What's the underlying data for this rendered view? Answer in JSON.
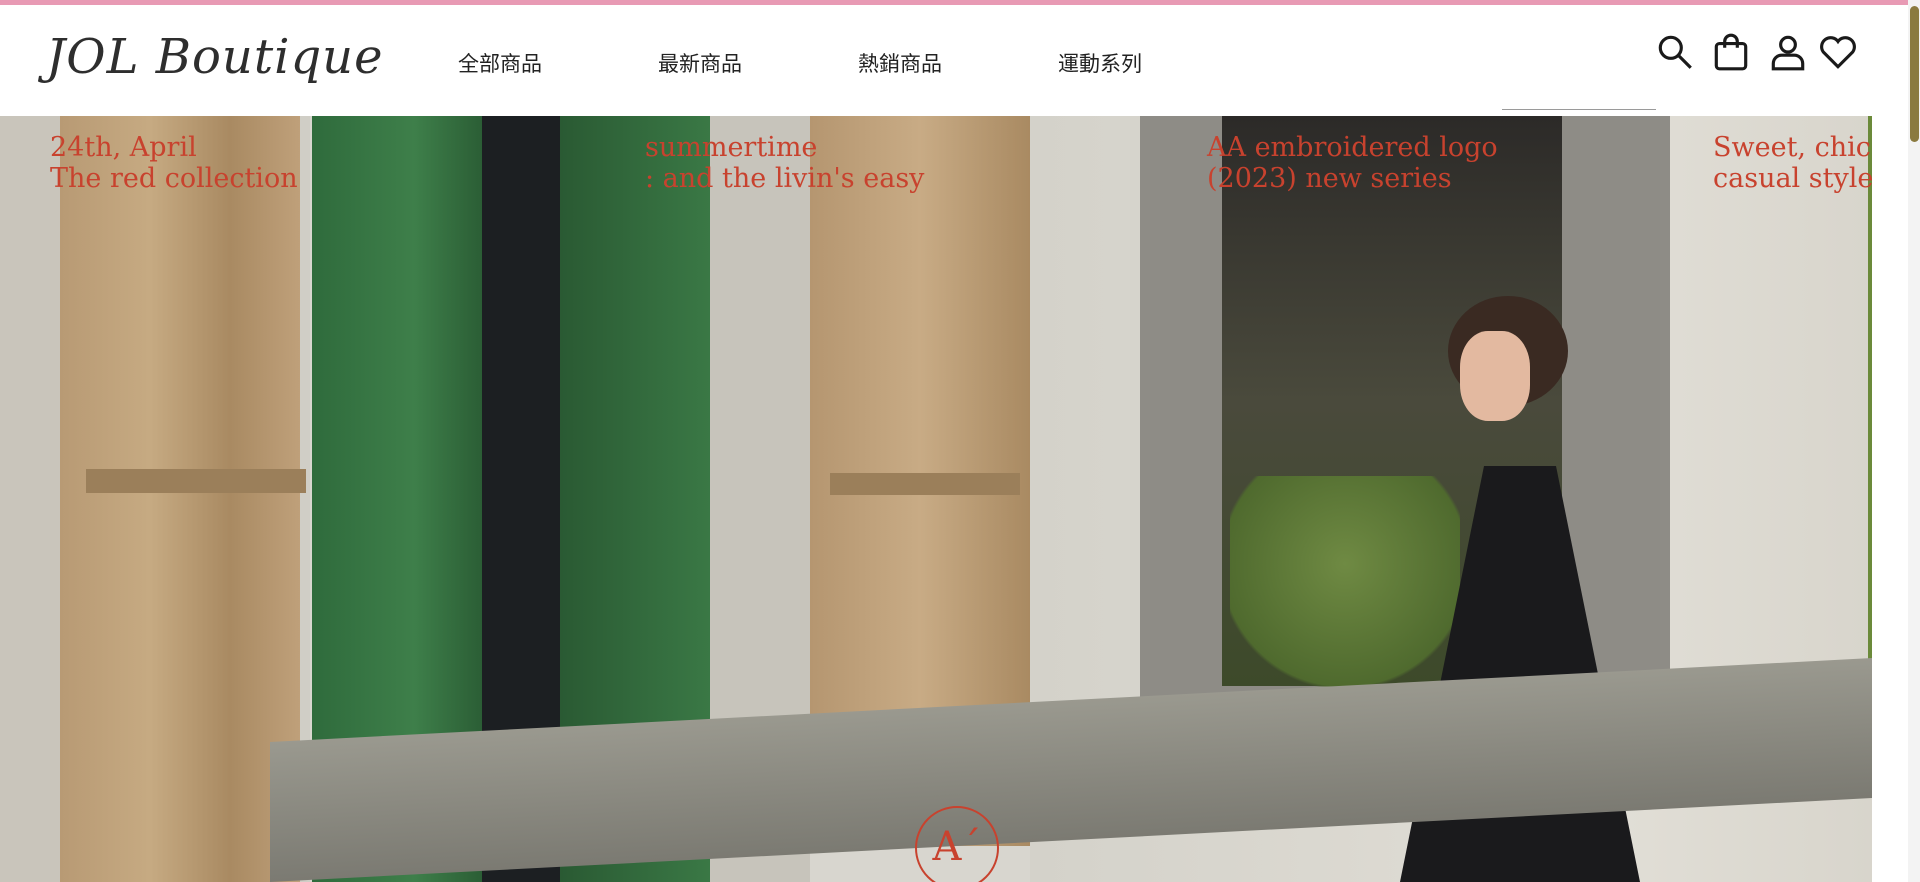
{
  "brand": {
    "logo_text": "JOL  Boutique"
  },
  "nav": {
    "items": [
      "全部商品",
      "最新商品",
      "熱銷商品",
      "運動系列"
    ]
  },
  "search": {
    "value": "",
    "placeholder": ""
  },
  "header_icons": [
    "search-icon",
    "shopping-bag-icon",
    "user-icon",
    "heart-icon"
  ],
  "hero": {
    "captions": [
      {
        "line1": "24th, April",
        "line2": "The red collection"
      },
      {
        "line1": "summertime",
        "line2": ": and the livin's easy"
      },
      {
        "line1": "AA embroidered logo",
        "line2": "(2023) new series"
      },
      {
        "line1": "Sweet, chic,",
        "line2": "casual style"
      }
    ],
    "badge": "A´"
  },
  "colors": {
    "top_accent": "#e89ab4",
    "caption_red": "#c8422e",
    "scroll_thumb": "#8a7a3f"
  }
}
